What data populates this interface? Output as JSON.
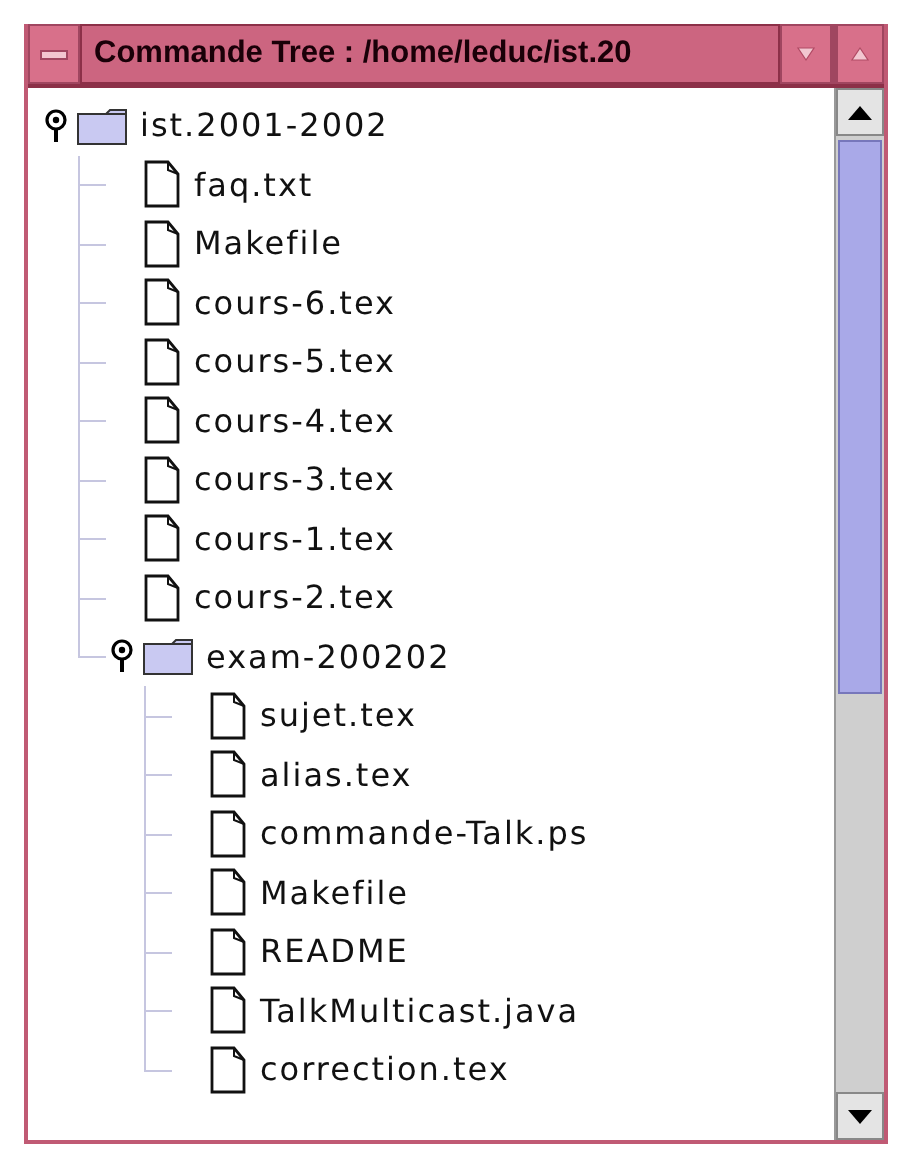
{
  "window": {
    "title": "Commande Tree : /home/leduc/ist.20"
  },
  "tree": [
    {
      "name": "ist.2001-2002",
      "kind": "folder",
      "expanded": true,
      "children": [
        {
          "name": "faq.txt",
          "kind": "file"
        },
        {
          "name": "Makefile",
          "kind": "file"
        },
        {
          "name": "cours-6.tex",
          "kind": "file"
        },
        {
          "name": "cours-5.tex",
          "kind": "file"
        },
        {
          "name": "cours-4.tex",
          "kind": "file"
        },
        {
          "name": "cours-3.tex",
          "kind": "file"
        },
        {
          "name": "cours-1.tex",
          "kind": "file"
        },
        {
          "name": "cours-2.tex",
          "kind": "file"
        },
        {
          "name": "exam-200202",
          "kind": "folder",
          "expanded": true,
          "children": [
            {
              "name": "sujet.tex",
              "kind": "file"
            },
            {
              "name": "alias.tex",
              "kind": "file"
            },
            {
              "name": "commande-Talk.ps",
              "kind": "file"
            },
            {
              "name": "Makefile",
              "kind": "file"
            },
            {
              "name": "README",
              "kind": "file"
            },
            {
              "name": "TalkMulticast.java",
              "kind": "file"
            },
            {
              "name": "correction.tex",
              "kind": "file"
            }
          ]
        }
      ]
    }
  ]
}
